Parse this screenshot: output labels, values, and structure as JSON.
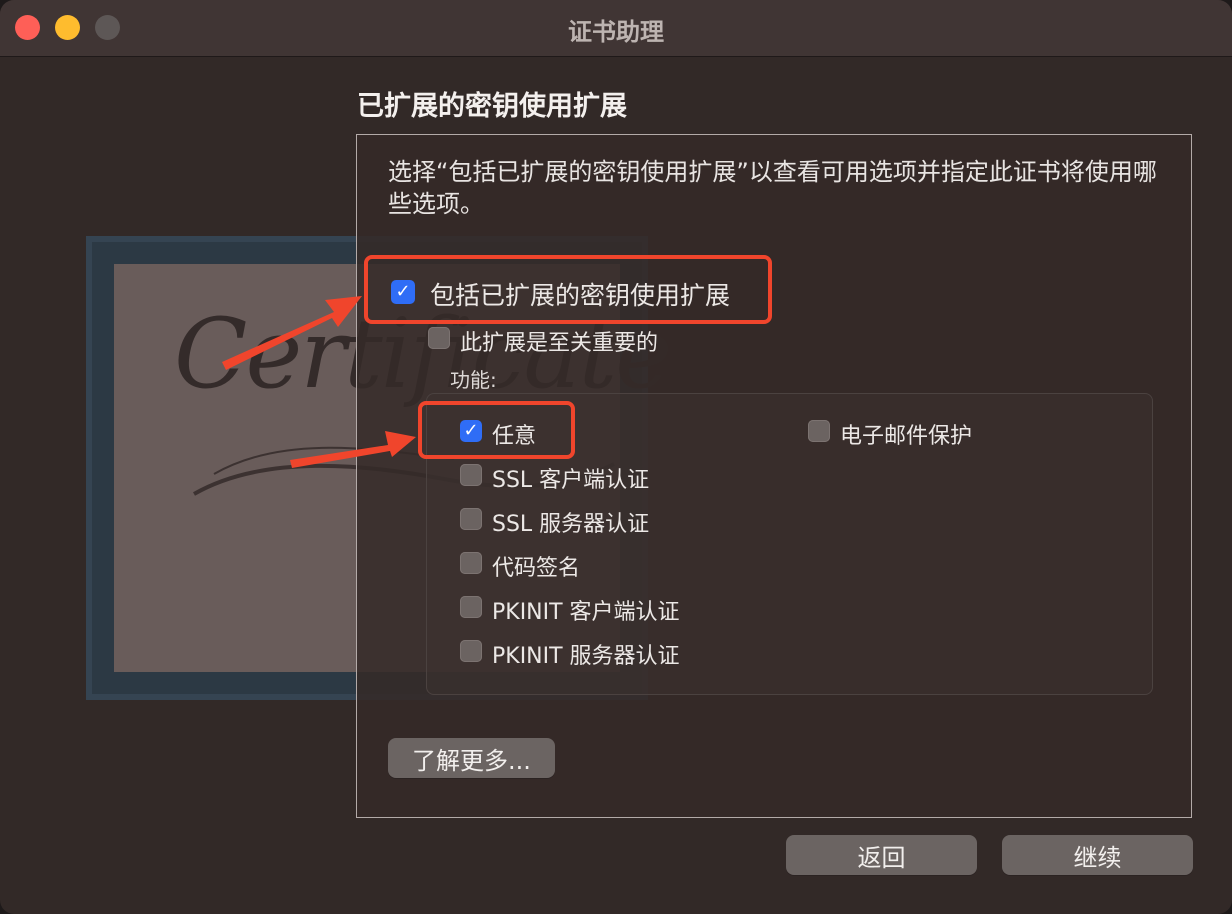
{
  "window": {
    "title": "证书助理"
  },
  "section": {
    "heading": "已扩展的密钥使用扩展",
    "description": "选择“包括已扩展的密钥使用扩展”以查看可用选项并指定此证书将使用哪些选项。"
  },
  "include_extension": {
    "label": "包括已扩展的密钥使用扩展",
    "checked": true
  },
  "critical": {
    "label": "此扩展是至关重要的",
    "checked": false
  },
  "capabilities": {
    "label": "功能:",
    "items": [
      {
        "label": "任意",
        "checked": true
      },
      {
        "label": "SSL 客户端认证",
        "checked": false
      },
      {
        "label": "SSL 服务器认证",
        "checked": false
      },
      {
        "label": "代码签名",
        "checked": false
      },
      {
        "label": "PKINIT 客户端认证",
        "checked": false
      },
      {
        "label": "PKINIT 服务器认证",
        "checked": false
      },
      {
        "label": "电子邮件保护",
        "checked": false
      }
    ]
  },
  "buttons": {
    "learn_more": "了解更多...",
    "back": "返回",
    "continue": "继续"
  },
  "illustration": {
    "word": "Certificate"
  },
  "colors": {
    "accent": "#2f6df6",
    "highlight": "#f0452c"
  }
}
